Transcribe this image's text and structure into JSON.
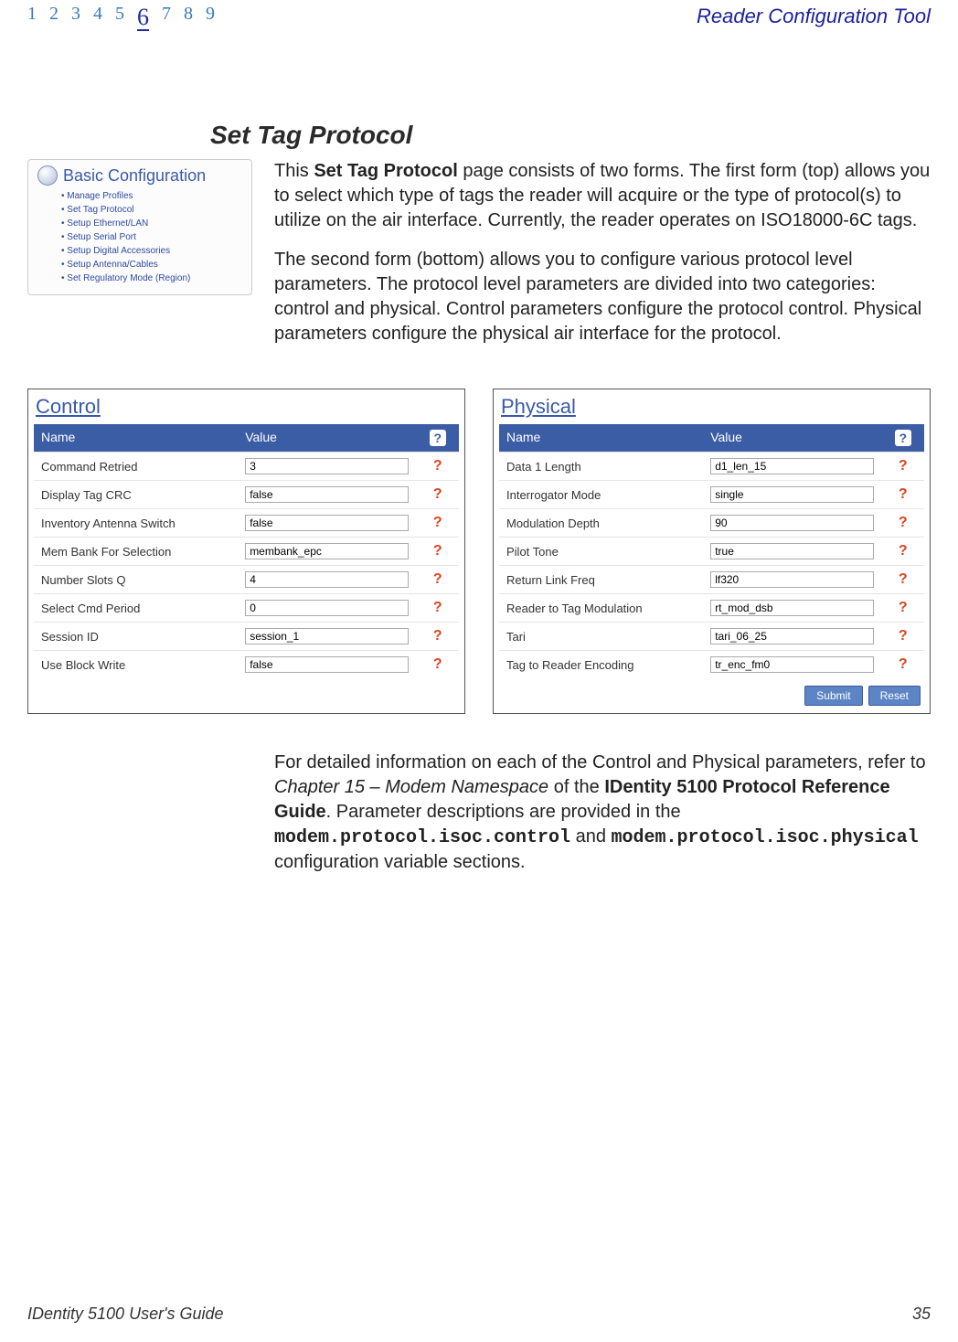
{
  "header": {
    "chapters": [
      "1",
      "2",
      "3",
      "4",
      "5",
      "6",
      "7",
      "8",
      "9"
    ],
    "current_chapter_index": 5,
    "right_title": "Reader Configuration Tool"
  },
  "section_title": "Set Tag Protocol",
  "sidebar": {
    "title": "Basic Configuration",
    "items": [
      "Manage Profiles",
      "Set Tag Protocol",
      "Setup Ethernet/LAN",
      "Setup Serial Port",
      "Setup Digital Accessories",
      "Setup Antenna/Cables",
      "Set Regulatory Mode (Region)"
    ]
  },
  "intro": {
    "p1_a": "This ",
    "p1_strong": "Set Tag Protocol",
    "p1_b": " page consists of two forms. The first form (top) allows you to select which type of tags the reader will acquire or the type of protocol(s) to utilize on the air interface. Currently, the reader operates on ISO18000-6C tags.",
    "p2": "The second form (bottom) allows you to configure various protocol level parameters. The protocol level parameters are divided into two categories: control and physical. Control parameters configure the protocol control. Physical parameters configure the physical air interface for the protocol."
  },
  "control_panel": {
    "title": "Control",
    "head_name": "Name",
    "head_value": "Value",
    "head_help": "?",
    "rows": [
      {
        "name": "Command Retried",
        "value": "3"
      },
      {
        "name": "Display Tag CRC",
        "value": "false"
      },
      {
        "name": "Inventory Antenna Switch",
        "value": "false"
      },
      {
        "name": "Mem Bank For Selection",
        "value": "membank_epc"
      },
      {
        "name": "Number Slots Q",
        "value": "4"
      },
      {
        "name": "Select Cmd Period",
        "value": "0"
      },
      {
        "name": "Session ID",
        "value": "session_1"
      },
      {
        "name": "Use Block Write",
        "value": "false"
      }
    ]
  },
  "physical_panel": {
    "title": "Physical",
    "head_name": "Name",
    "head_value": "Value",
    "head_help": "?",
    "rows": [
      {
        "name": "Data 1 Length",
        "value": "d1_len_15"
      },
      {
        "name": "Interrogator Mode",
        "value": "single"
      },
      {
        "name": "Modulation Depth",
        "value": "90"
      },
      {
        "name": "Pilot Tone",
        "value": "true"
      },
      {
        "name": "Return Link Freq",
        "value": "lf320"
      },
      {
        "name": "Reader to Tag Modulation",
        "value": "rt_mod_dsb"
      },
      {
        "name": "Tari",
        "value": "tari_06_25"
      },
      {
        "name": "Tag to Reader Encoding",
        "value": "tr_enc_fm0"
      }
    ],
    "submit": "Submit",
    "reset": "Reset"
  },
  "bottom_paragraph": {
    "t1": "For detailed information on each of the Control and Physical parameters, refer to ",
    "em": "Chapter 15 – Modem Namespace",
    "t2": " of the ",
    "bold1": "IDentity 5100 Protocol Reference Guide",
    "t3": ".  Parameter descriptions are provided in the ",
    "mono1": "modem.protocol.isoc.control",
    "t4": " and ",
    "mono2": "modem.protocol.isoc.physical",
    "t5": " configuration variable sections."
  },
  "footer": {
    "left": "IDentity 5100 User's Guide",
    "right": "35"
  }
}
